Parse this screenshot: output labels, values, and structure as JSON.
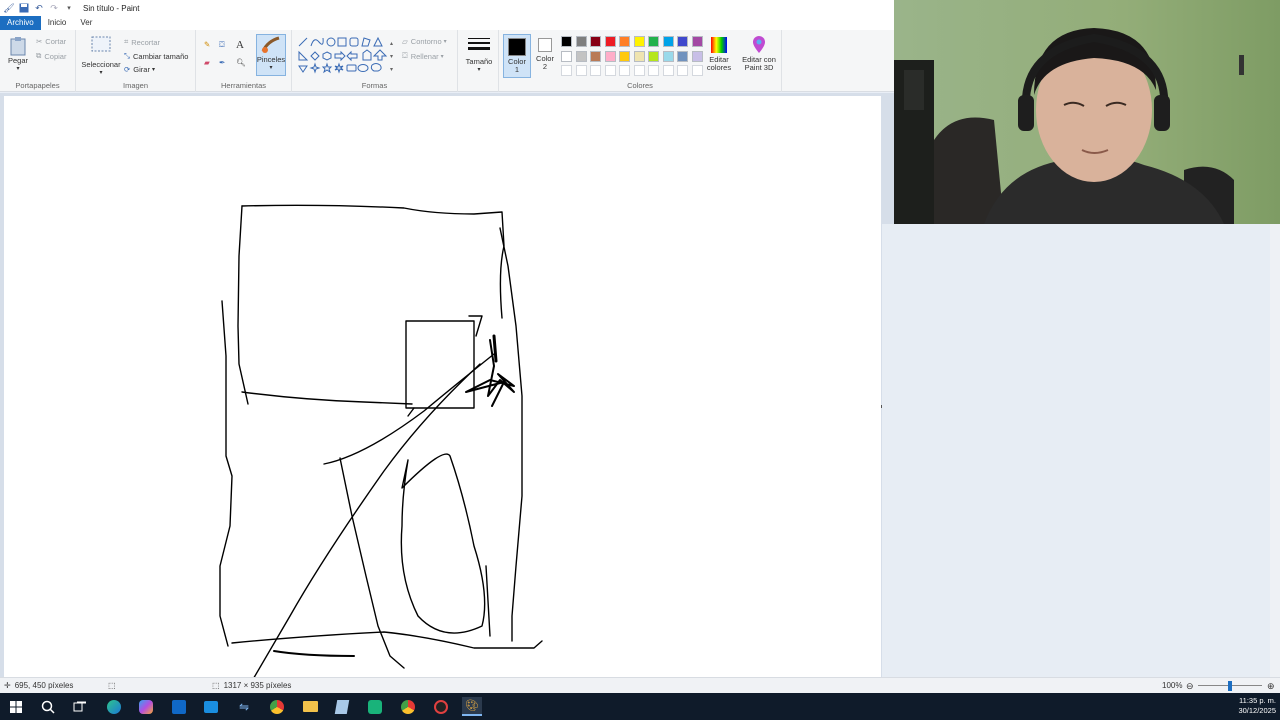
{
  "window": {
    "title": "Sin título - Paint"
  },
  "tabs": [
    {
      "label": "Archivo",
      "active": true
    },
    {
      "label": "Inicio"
    },
    {
      "label": "Ver"
    }
  ],
  "ribbon": {
    "clipboard": {
      "label": "Portapapeles",
      "paste": "Pegar",
      "cut": "Cortar",
      "copy": "Copiar"
    },
    "image": {
      "label": "Imagen",
      "select": "Seleccionar",
      "crop": "Recortar",
      "resize": "Cambiar tamaño",
      "rotate": "Girar"
    },
    "tools": {
      "label": "Herramientas",
      "brushes": "Pinceles"
    },
    "shapes": {
      "label": "Formas",
      "outline": "Contorno",
      "fill": "Rellenar"
    },
    "size": {
      "label": "Tamaño"
    },
    "colors": {
      "label": "Colores",
      "color1": "Color 1",
      "color2": "Color 2",
      "edit": "Editar colores",
      "paint3d": "Editar con Paint 3D",
      "palette_row1": [
        "#000000",
        "#7f7f7f",
        "#880015",
        "#ed1c24",
        "#ff7f27",
        "#fff200",
        "#22b14c",
        "#00a2e8",
        "#3f48cc",
        "#a349a4"
      ],
      "palette_row2": [
        "#ffffff",
        "#c3c3c3",
        "#b97a57",
        "#ffaec9",
        "#ffc90e",
        "#efe4b0",
        "#b5e61d",
        "#99d9ea",
        "#7092be",
        "#c8bfe7"
      ]
    }
  },
  "status": {
    "cursor_pos": "695, 450 píxeles",
    "image_size": "1317 × 935 píxeles",
    "zoom": "100%",
    "zoom_fraction": 0.5
  },
  "taskbar": {
    "time": "11:35 p. m.",
    "date": "30/12/2025"
  }
}
